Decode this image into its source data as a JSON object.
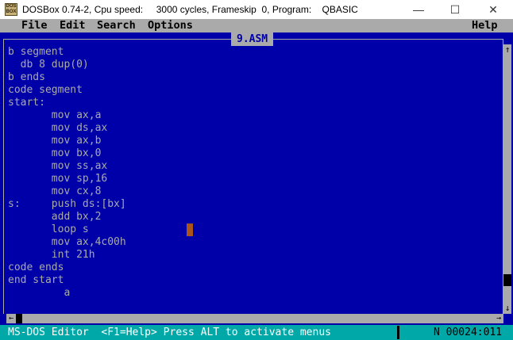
{
  "window": {
    "icon_text": "DOS BOX",
    "title": "DOSBox 0.74-2, Cpu speed:     3000 cycles, Frameskip  0, Program:    QBASIC",
    "minimize": "—",
    "maximize": "☐",
    "close": "✕"
  },
  "menu": {
    "file": "File",
    "edit": "Edit",
    "search": "Search",
    "options": "Options",
    "help": "Help"
  },
  "document": {
    "title": "9.ASM"
  },
  "code_lines": [
    "b segment",
    "  db 8 dup(0)",
    "b ends",
    "code segment",
    "start:",
    "       mov ax,a",
    "       mov ds,ax",
    "       mov ax,b",
    "       mov bx,0",
    "       mov ss,ax",
    "       mov sp,16",
    "       mov cx,8",
    "s:     push ds:[bx]",
    "       add bx,2",
    "       loop s",
    "       mov ax,4c00h",
    "       int 21h",
    "code ends",
    "end start",
    "         a"
  ],
  "scrollbar": {
    "up_arrow": "↑",
    "down_arrow": "↓",
    "left_arrow": "←",
    "right_arrow": "→"
  },
  "status": {
    "message": "MS-DOS Editor  <F1=Help> Press ALT to activate menus",
    "position": "N 00024:011"
  },
  "colors": {
    "background": "#0000a8",
    "text": "#aaaaaa",
    "menubar": "#aaaaaa",
    "statusbar": "#00a8a8",
    "cursor": "#a8541a"
  }
}
